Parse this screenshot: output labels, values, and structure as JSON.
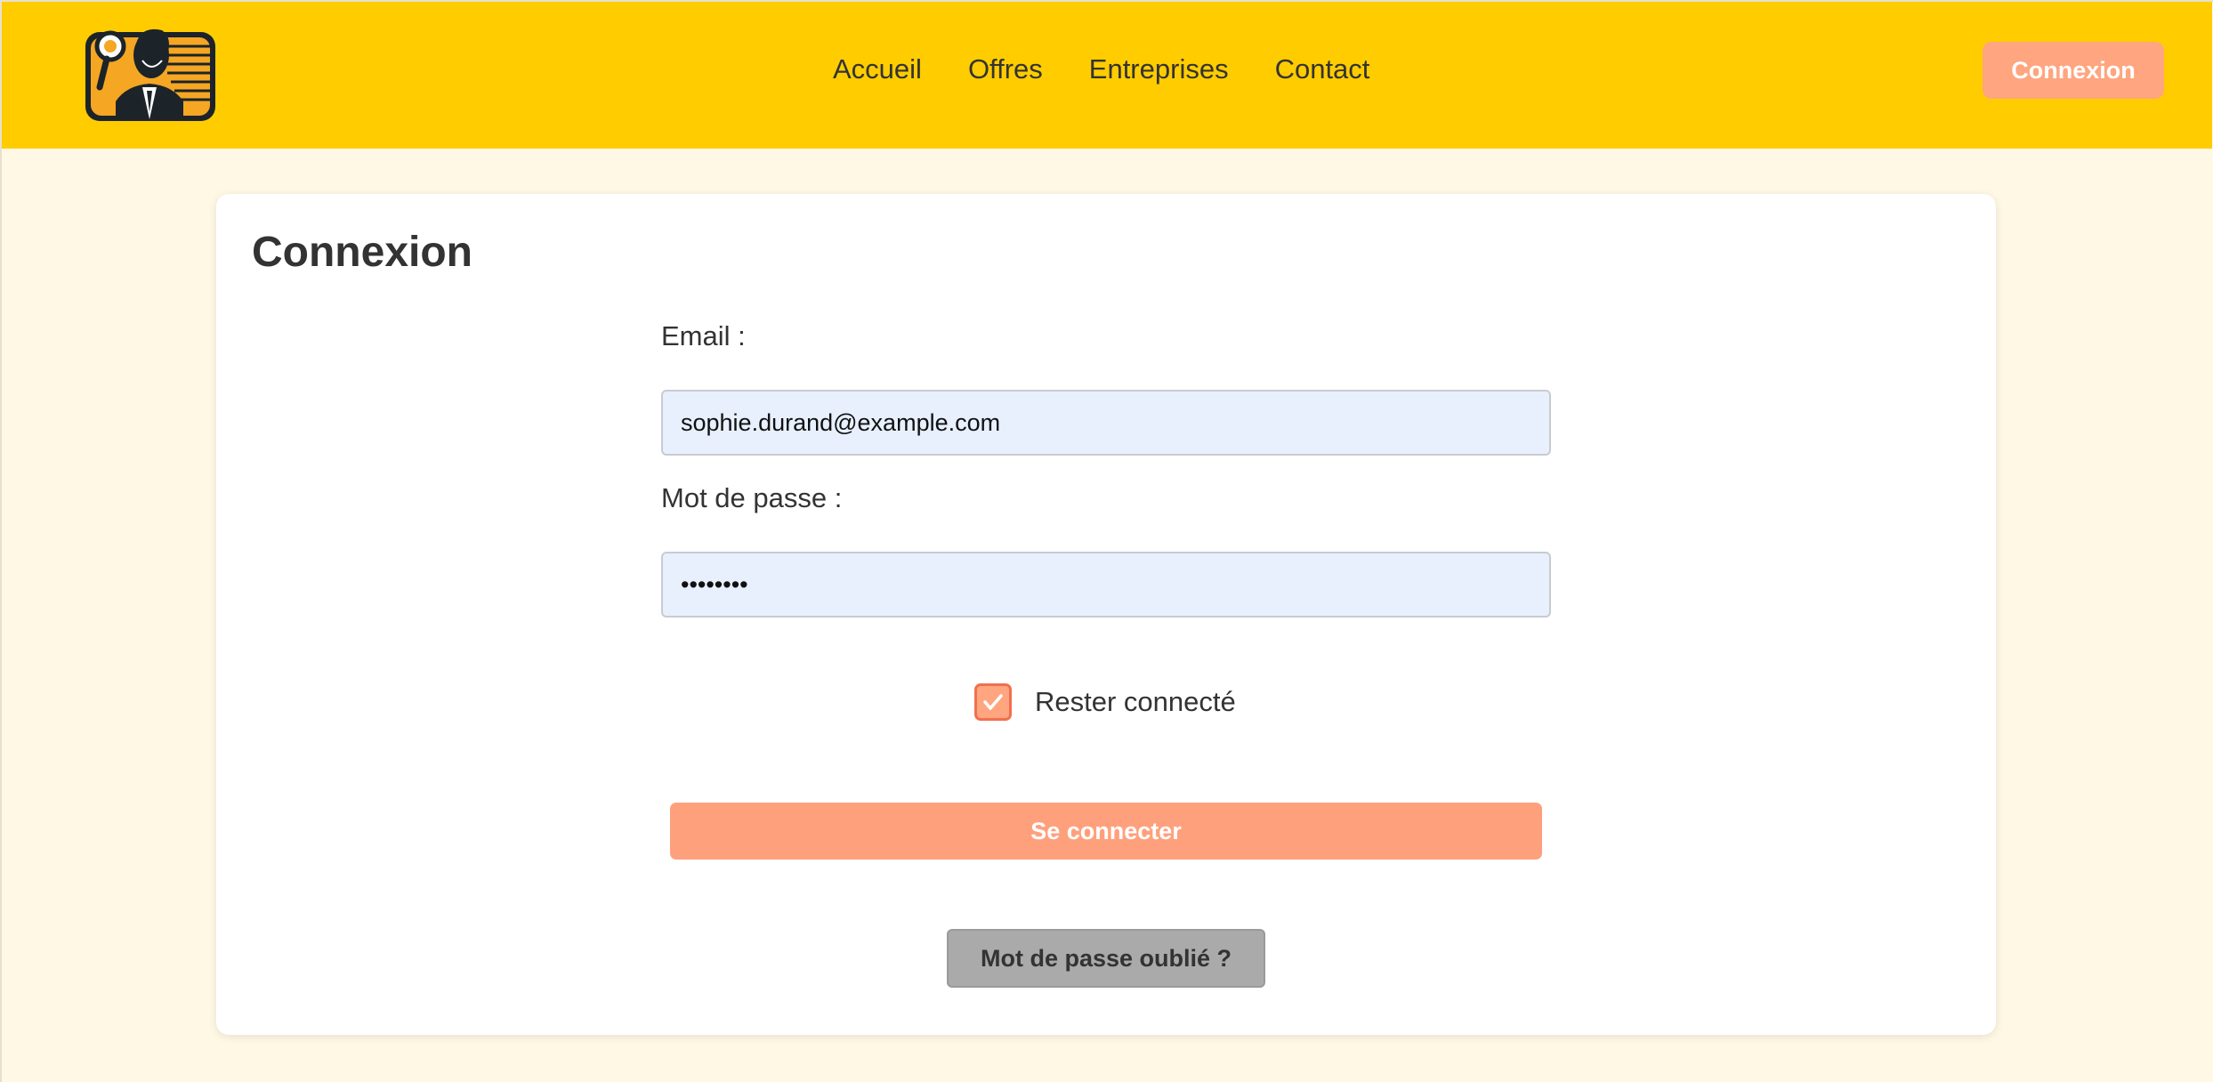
{
  "header": {
    "nav": [
      {
        "label": "Accueil"
      },
      {
        "label": "Offres"
      },
      {
        "label": "Entreprises"
      },
      {
        "label": "Contact"
      }
    ],
    "login_label": "Connexion"
  },
  "form": {
    "title": "Connexion",
    "email_label": "Email :",
    "email_value": "sophie.durand@example.com",
    "password_label": "Mot de passe :",
    "password_value": "••••••••",
    "remember_label": "Rester connecté",
    "remember_checked": true,
    "submit_label": "Se connecter",
    "forgot_label": "Mot de passe oublié ?"
  },
  "colors": {
    "header_bg": "#ffcc00",
    "page_bg": "#fff8e5",
    "accent": "#ffa57f",
    "input_bg": "#e8f0fe",
    "forgot_bg": "#aaaaaa"
  },
  "icons": {
    "logo": "businessman-magnifier-logo",
    "checkbox": "check-icon"
  }
}
